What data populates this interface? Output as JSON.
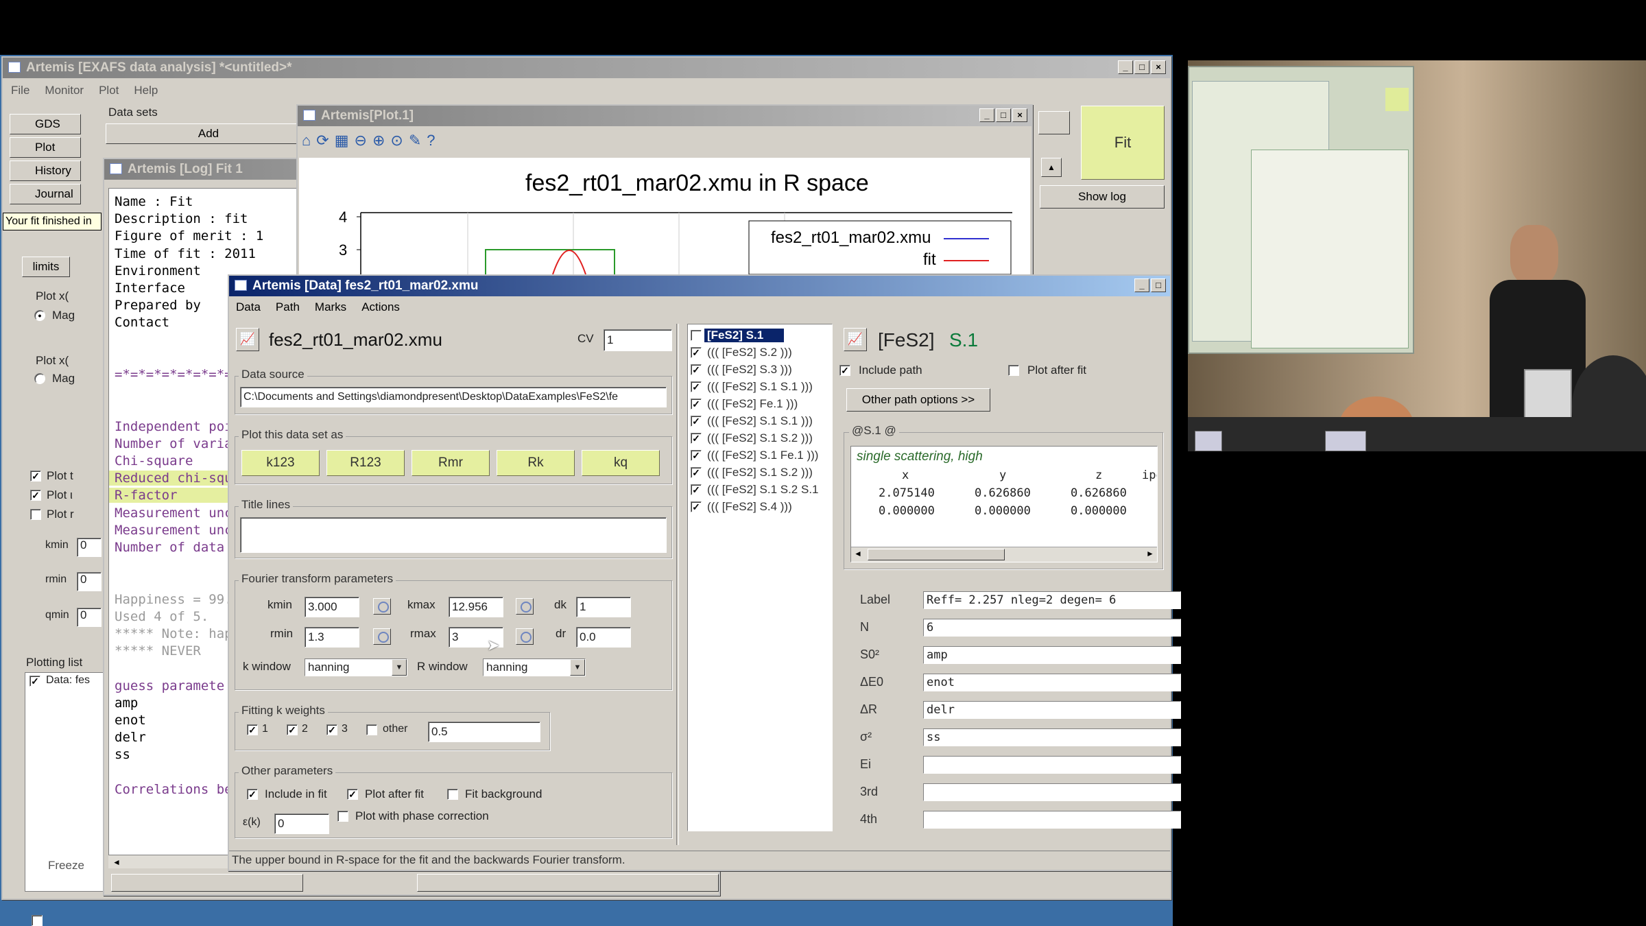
{
  "colors": {
    "desktop": "#3a6ea5",
    "active_title": "#0a246a",
    "fit_button": "#e5efa0",
    "window": "#d4d0c8"
  },
  "main": {
    "title": "Artemis [EXAFS data analysis] *<untitled>*",
    "menu": [
      "File",
      "Monitor",
      "Plot",
      "Help"
    ],
    "side_buttons": [
      "GDS",
      "Plot",
      "History",
      "Journal"
    ],
    "status": "Your fit finished in",
    "datasets_label": "Data sets",
    "add_label": "Add",
    "fit_label": "Fit",
    "showlog_label": "Show log",
    "left": {
      "limits": "limits",
      "plotx1": "Plot x(",
      "mag1": "Mag",
      "plotx2": "Plot x(",
      "mag2": "Mag",
      "plotchk": [
        "Plot t",
        "Plot ι",
        "Plot r"
      ],
      "kmin": "kmin",
      "kmin_v": "0",
      "rmin": "rmin",
      "rmin_v": "0",
      "qmin": "qmin",
      "qmin_v": "0",
      "plotting_list": "Plotting list",
      "data_item": "Data: fes",
      "freeze": "Freeze"
    }
  },
  "log": {
    "title": "Artemis [Log] Fit 1",
    "lines": [
      {
        "t": "Name              : Fit",
        "c": "#000"
      },
      {
        "t": "Description       : fit",
        "c": "#000"
      },
      {
        "t": "Figure of merit   : 1",
        "c": "#000"
      },
      {
        "t": "Time of fit       : 2011",
        "c": "#000"
      },
      {
        "t": "Environment",
        "c": "#000"
      },
      {
        "t": "Interface",
        "c": "#000"
      },
      {
        "t": "Prepared by",
        "c": "#000"
      },
      {
        "t": "Contact",
        "c": "#000"
      },
      {
        "t": "",
        "c": "#000"
      },
      {
        "t": "",
        "c": "#000"
      },
      {
        "t": "=*=*=*=*=*=*=*=*",
        "c": "#7a3b8c"
      },
      {
        "t": "",
        "c": "#000"
      },
      {
        "t": "",
        "c": "#000"
      },
      {
        "t": "Independent poi",
        "c": "#7a3b8c"
      },
      {
        "t": "Number of varia",
        "c": "#7a3b8c"
      },
      {
        "t": "Chi-square",
        "c": "#7a3b8c"
      },
      {
        "t": "Reduced chi-squ",
        "c": "#7a3b8c"
      },
      {
        "t": "R-factor",
        "c": "#7a3b8c"
      },
      {
        "t": "Measurement unc",
        "c": "#7a3b8c"
      },
      {
        "t": "Measurement unc",
        "c": "#7a3b8c"
      },
      {
        "t": "Number of data",
        "c": "#7a3b8c"
      },
      {
        "t": "",
        "c": "#000"
      },
      {
        "t": "",
        "c": "#000"
      },
      {
        "t": "Happiness = 99.",
        "c": "#9a9a9a"
      },
      {
        "t": "  Used 4 of 5.",
        "c": "#9a9a9a"
      },
      {
        "t": "***** Note: hap",
        "c": "#9a9a9a"
      },
      {
        "t": "*****     NEVER",
        "c": "#9a9a9a"
      },
      {
        "t": "",
        "c": "#000"
      },
      {
        "t": "guess paramete",
        "c": "#7a3b8c"
      },
      {
        "t": "  amp",
        "c": "#000"
      },
      {
        "t": "  enot",
        "c": "#000"
      },
      {
        "t": "  delr",
        "c": "#000"
      },
      {
        "t": "  ss",
        "c": "#000"
      },
      {
        "t": "",
        "c": "#000"
      },
      {
        "t": "Correlations be",
        "c": "#7a3b8c"
      }
    ]
  },
  "plot": {
    "title": "Artemis[Plot.1]",
    "chart_title": "fes2_rt01_mar02.xmu in R space",
    "y_ticks": [
      "4",
      "3"
    ],
    "legend": [
      {
        "name": "fes2_rt01_mar02.xmu",
        "color": "#3030d0"
      },
      {
        "name": "fit",
        "color": "#e02020"
      }
    ]
  },
  "data": {
    "title": "Artemis [Data] fes2_rt01_mar02.xmu",
    "menu": [
      "Data",
      "Path",
      "Marks",
      "Actions"
    ],
    "file_name": "fes2_rt01_mar02.xmu",
    "cv_label": "CV",
    "cv_value": "1",
    "source_label": "Data source",
    "source_path": "C:\\Documents and Settings\\diamondpresent\\Desktop\\DataExamples\\FeS2\\fe",
    "plot_as_label": "Plot this data set as",
    "plot_buttons": [
      "k123",
      "R123",
      "Rmr",
      "Rk",
      "kq"
    ],
    "title_lines_label": "Title lines",
    "ft_label": "Fourier transform parameters",
    "kmin_l": "kmin",
    "kmin": "3.000",
    "kmax_l": "kmax",
    "kmax": "12.956",
    "dk_l": "dk",
    "dk": "1",
    "rmin_l": "rmin",
    "rmin": "1.3",
    "rmax_l": "rmax",
    "rmax": "3",
    "dr_l": "dr",
    "dr": "0.0",
    "kwin_l": "k window",
    "kwin": "hanning",
    "rwin_l": "R window",
    "rwin": "hanning",
    "kw_label": "Fitting k weights",
    "kw": [
      "1",
      "2",
      "3"
    ],
    "kw_other": "other",
    "kw_other_v": "0.5",
    "other_label": "Other parameters",
    "include": "Include in fit",
    "plot_after": "Plot after fit",
    "fit_bkg": "Fit background",
    "epsk_l": "ε(k)",
    "epsk": "0",
    "phase": "Plot with phase correction",
    "statusbar": "The upper bound in R-space for the fit and the backwards Fourier transform."
  },
  "paths": {
    "items": [
      {
        "label": "[FeS2]  S.1",
        "selected": true
      },
      {
        "label": "((( [FeS2]  S.2 )))"
      },
      {
        "label": "((( [FeS2]  S.3 )))"
      },
      {
        "label": "((( [FeS2]  S.1 S.1 )))"
      },
      {
        "label": "((( [FeS2]  Fe.1 )))"
      },
      {
        "label": "((( [FeS2]  S.1 S.1 )))"
      },
      {
        "label": "((( [FeS2]  S.1 S.2 )))"
      },
      {
        "label": "((( [FeS2]  S.1 Fe.1 )))"
      },
      {
        "label": "((( [FeS2]  S.1 S.2 )))"
      },
      {
        "label": "((( [FeS2]  S.1 S.2 S.1"
      },
      {
        "label": "((( [FeS2]  S.4 )))"
      }
    ],
    "header_fes": "[FeS2]",
    "header_s": "S.1",
    "include": "Include path",
    "plot_after": "Plot after fit",
    "other_opts": "Other path options >>",
    "geom_label": "@S.1   @",
    "geom_desc": "single scattering, high",
    "geom_header": [
      "x",
      "y",
      "z",
      "ipo"
    ],
    "geom_rows": [
      [
        "2.075140",
        "0.626860",
        "0.626860"
      ],
      [
        "0.000000",
        "0.000000",
        "0.000000"
      ]
    ],
    "params": [
      {
        "k": "Label",
        "v": "Reff=  2.257   nleg=2   degen= 6"
      },
      {
        "k": "N",
        "v": "6"
      },
      {
        "k": "S0²",
        "v": "amp"
      },
      {
        "k": "ΔE0",
        "v": "enot"
      },
      {
        "k": "ΔR",
        "v": "delr"
      },
      {
        "k": "σ²",
        "v": "ss"
      },
      {
        "k": "Ei",
        "v": ""
      },
      {
        "k": "3rd",
        "v": ""
      },
      {
        "k": "4th",
        "v": ""
      }
    ]
  }
}
